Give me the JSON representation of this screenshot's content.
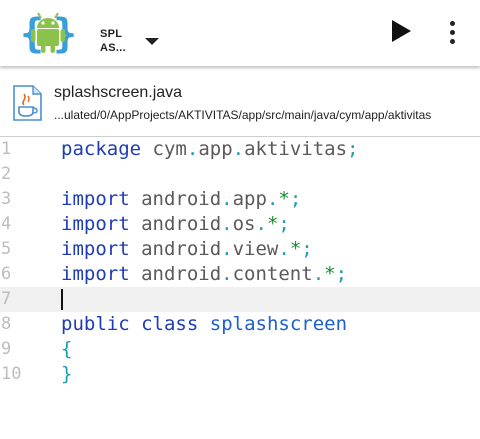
{
  "toolbar": {
    "project_name_line1": "SPL",
    "project_name_line2": "AS...",
    "logo_icon": "android-logo-icon",
    "run_icon": "play-icon",
    "menu_icon": "more-vert-icon"
  },
  "file": {
    "name": "splashscreen.java",
    "path": "...ulated/0/AppProjects/AKTIVITAS/app/src/main/java/cym/app/aktivitas",
    "icon": "java-file-icon"
  },
  "editor": {
    "current_line": 7,
    "lines": [
      {
        "number": "1",
        "tokens": [
          {
            "t": "package",
            "c": "kw"
          },
          {
            "t": " ",
            "c": "id"
          },
          {
            "t": "cym",
            "c": "id"
          },
          {
            "t": ".",
            "c": "punct"
          },
          {
            "t": "app",
            "c": "id"
          },
          {
            "t": ".",
            "c": "punct"
          },
          {
            "t": "aktivitas",
            "c": "id"
          },
          {
            "t": ";",
            "c": "punct"
          }
        ]
      },
      {
        "number": "2",
        "tokens": []
      },
      {
        "number": "3",
        "tokens": [
          {
            "t": "import",
            "c": "kw"
          },
          {
            "t": " android",
            "c": "id"
          },
          {
            "t": ".",
            "c": "punct"
          },
          {
            "t": "app",
            "c": "id"
          },
          {
            "t": ".",
            "c": "punct"
          },
          {
            "t": "*",
            "c": "star"
          },
          {
            "t": ";",
            "c": "punct"
          }
        ]
      },
      {
        "number": "4",
        "tokens": [
          {
            "t": "import",
            "c": "kw"
          },
          {
            "t": " android",
            "c": "id"
          },
          {
            "t": ".",
            "c": "punct"
          },
          {
            "t": "os",
            "c": "id"
          },
          {
            "t": ".",
            "c": "punct"
          },
          {
            "t": "*",
            "c": "star"
          },
          {
            "t": ";",
            "c": "punct"
          }
        ]
      },
      {
        "number": "5",
        "tokens": [
          {
            "t": "import",
            "c": "kw"
          },
          {
            "t": " android",
            "c": "id"
          },
          {
            "t": ".",
            "c": "punct"
          },
          {
            "t": "view",
            "c": "id"
          },
          {
            "t": ".",
            "c": "punct"
          },
          {
            "t": "*",
            "c": "star"
          },
          {
            "t": ";",
            "c": "punct"
          }
        ]
      },
      {
        "number": "6",
        "tokens": [
          {
            "t": "import",
            "c": "kw"
          },
          {
            "t": " android",
            "c": "id"
          },
          {
            "t": ".",
            "c": "punct"
          },
          {
            "t": "content",
            "c": "id"
          },
          {
            "t": ".",
            "c": "punct"
          },
          {
            "t": "*",
            "c": "star"
          },
          {
            "t": ";",
            "c": "punct"
          }
        ]
      },
      {
        "number": "7",
        "tokens": []
      },
      {
        "number": "8",
        "tokens": [
          {
            "t": "public",
            "c": "kw"
          },
          {
            "t": " ",
            "c": "id"
          },
          {
            "t": "class",
            "c": "kw"
          },
          {
            "t": " ",
            "c": "id"
          },
          {
            "t": "splashscreen",
            "c": "cls"
          }
        ]
      },
      {
        "number": "9",
        "tokens": [
          {
            "t": "{",
            "c": "punct"
          }
        ]
      },
      {
        "number": "10",
        "tokens": [
          {
            "t": "}",
            "c": "punct"
          }
        ]
      }
    ]
  },
  "colors": {
    "keyword": "#1e3cb4",
    "identifier": "#5a5a5a",
    "punctuation": "#1b9bb5",
    "wildcard": "#1a8a32",
    "class_name": "#1d5fd0",
    "line_number": "#bdbdbd",
    "current_line_bg": "#f0f0f0"
  }
}
